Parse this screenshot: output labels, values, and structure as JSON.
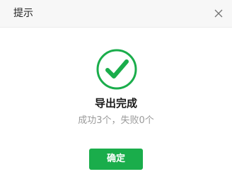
{
  "dialog": {
    "title": "提示",
    "close_icon": "close-icon",
    "status_icon": "checkmark-circle-icon",
    "result_title": "导出完成",
    "result_summary": "成功3个，失败0个",
    "confirm_label": "确定",
    "accent_color": "#1aad4b"
  }
}
